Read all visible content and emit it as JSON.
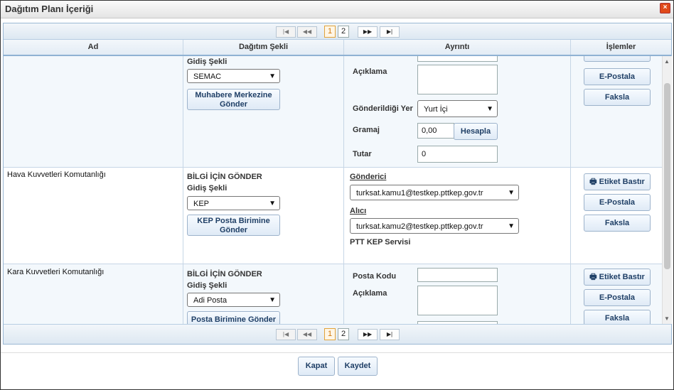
{
  "window": {
    "title": "Dağıtım Planı İçeriği",
    "close_glyph": "×"
  },
  "pager": {
    "first": "|◀",
    "prev": "◀◀",
    "pages": [
      "1",
      "2"
    ],
    "active_page": "1",
    "next": "▶▶",
    "last": "▶|"
  },
  "columns": {
    "ad": "Ad",
    "dagitim": "Dağıtım Şekli",
    "ayrinti": "Ayrıntı",
    "islemler": "İşlemler"
  },
  "rows": [
    {
      "ad": "",
      "gidis_label": "Gidiş Şekli",
      "gidis_value": "SEMAC",
      "send_button": "Muhabere Merkezine Gönder",
      "aciklama_label": "Açıklama",
      "gonderildigi_label": "Gönderildiği Yer",
      "gonderildigi_value": "Yurt İçi",
      "gramaj_label": "Gramaj",
      "gramaj_value": "0,00",
      "hesapla": "Hesapla",
      "tutar_label": "Tutar",
      "tutar_value": "0",
      "actions": [
        "E-Postala",
        "Faksla"
      ]
    },
    {
      "ad": "Hava Kuvvetleri Komutanlığı",
      "bilgi": "BİLGİ İÇİN GÖNDER",
      "gidis_label": "Gidiş Şekli",
      "gidis_value": "KEP",
      "send_button": "KEP Posta Birimine Gönder",
      "gonderici_label": "Gönderici",
      "gonderici_value": "turksat.kamu1@testkep.pttkep.gov.tr",
      "alici_label": "Alıcı",
      "alici_value": "turksat.kamu2@testkep.pttkep.gov.tr",
      "servis": "PTT KEP Servisi",
      "actions": [
        "Etiket Bastır",
        "E-Postala",
        "Faksla"
      ]
    },
    {
      "ad": "Kara Kuvvetleri Komutanlığı",
      "bilgi": "BİLGİ İÇİN GÖNDER",
      "gidis_label": "Gidiş Şekli",
      "gidis_value": "Adi Posta",
      "send_button": "Posta Birimine Gönder",
      "posta_kodu_label": "Posta Kodu",
      "aciklama_label": "Açıklama",
      "actions": [
        "Etiket Bastır",
        "E-Postala",
        "Faksla"
      ]
    }
  ],
  "footer": {
    "kapat": "Kapat",
    "kaydet": "Kaydet"
  },
  "icons": {
    "close": "close-icon",
    "printer": "printer-icon",
    "chevron": "chevron-down-icon"
  }
}
